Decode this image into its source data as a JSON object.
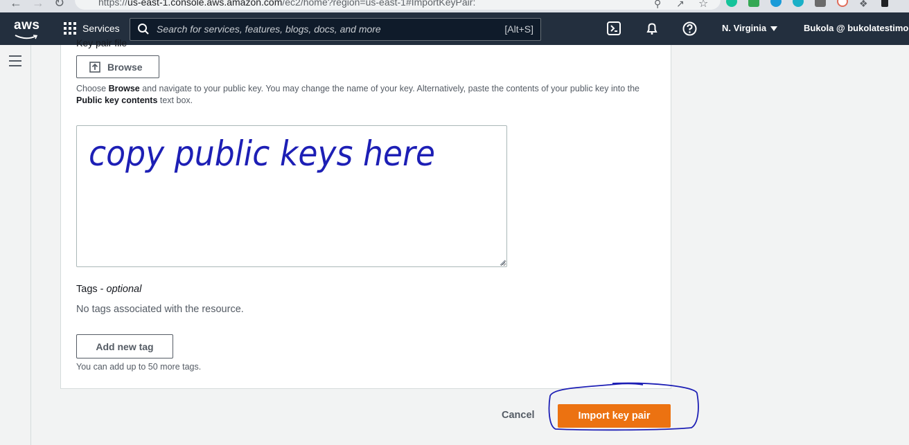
{
  "browser": {
    "url_prefix": "https://",
    "url_host": "us-east-1.console.aws.amazon.com",
    "url_path": "/ec2/home?region=us-east-1#ImportKeyPair:"
  },
  "topnav": {
    "logo_text": "aws",
    "services_label": "Services",
    "search_placeholder": "Search for services, features, blogs, docs, and more",
    "search_shortcut": "[Alt+S]",
    "region_label": "N. Virginia",
    "account_label": "Bukola @ bukolatestimon"
  },
  "form": {
    "key_pair_file_label": "Key pair file",
    "browse_label": "Browse",
    "help_text_parts": {
      "p1": "Choose ",
      "b1": "Browse",
      "p2": " and navigate to your public key. You may change the name of your key. Alternatively, paste the contents of your public key into the ",
      "b2": "Public key contents",
      "p3": " text box."
    },
    "public_key_value": "",
    "annotation_text": "copy public keys here",
    "tags_label": "Tags - ",
    "tags_optional": "optional",
    "no_tags_text": "No tags associated with the resource.",
    "add_tag_label": "Add new tag",
    "tag_limit_text": "You can add up to 50 more tags."
  },
  "footer": {
    "cancel_label": "Cancel",
    "import_label": "Import key pair"
  },
  "colors": {
    "nav_bg": "#232f3e",
    "primary_button": "#ec7211",
    "annotation_ink": "#1d1fb5"
  }
}
